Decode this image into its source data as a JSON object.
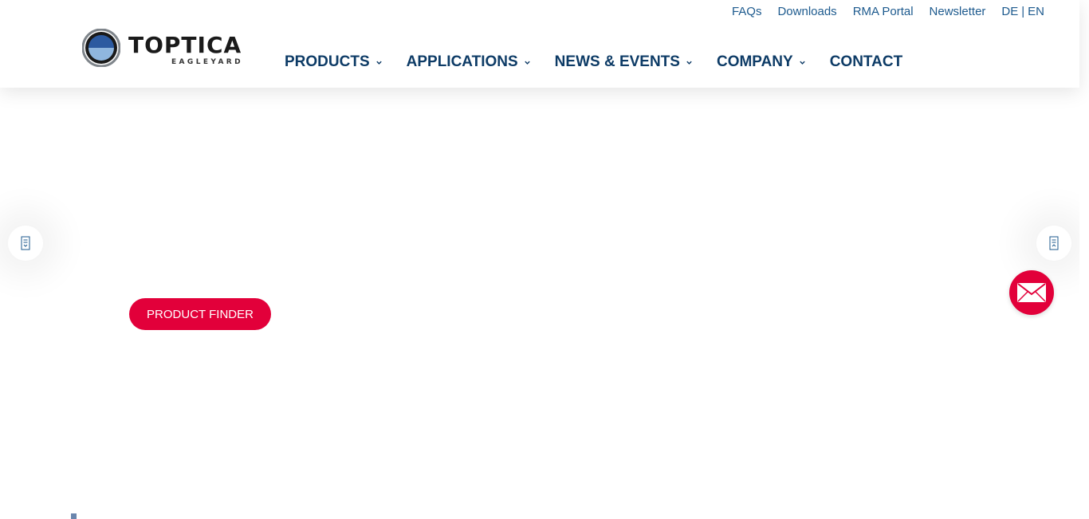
{
  "brand": {
    "name": "TOPTICA",
    "sub": "EAGLEYARD",
    "colors": {
      "navy": "#0d3b66",
      "link": "#1d5a8e",
      "accent": "#e2003a"
    }
  },
  "top_links": {
    "faqs": "FAQs",
    "downloads": "Downloads",
    "rma": "RMA Portal",
    "newsletter": "Newsletter",
    "lang_de": "DE",
    "lang_sep": "|",
    "lang_en": "EN"
  },
  "nav": {
    "products": "PRODUCTS",
    "applications": "APPLICATIONS",
    "news": "NEWS & EVENTS",
    "company": "COMPANY",
    "contact": "CONTACT"
  },
  "hero": {
    "cta": "PRODUCT FINDER",
    "prev_icon": "slider-prev-icon",
    "next_icon": "slider-next-icon",
    "mail_icon": "mail-icon"
  }
}
